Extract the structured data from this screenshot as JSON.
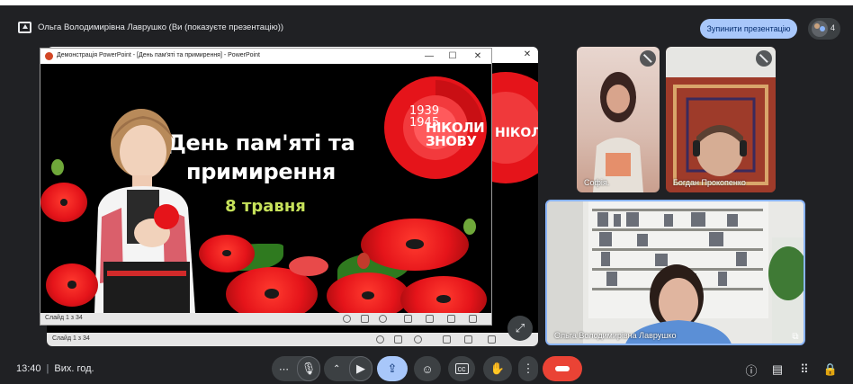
{
  "header": {
    "title": "Ольга Володимирівна Лаврушко (Ви (показуєте презентацію))",
    "stop_button": "Зупинити презентацію",
    "participants_count": "4"
  },
  "presentation": {
    "window_title": "Демонстрація PowerPoint - [День пам'яті та примирення] - PowerPoint",
    "slide_counter": "Слайд 1 з 34",
    "back_slide_counter": "Слайд 1 з 34",
    "slide": {
      "heading_line1": "День пам'яті та",
      "heading_line2": "примирення",
      "date": "8 травня",
      "emblem_years_top": "1939",
      "emblem_years_bottom": "1945",
      "emblem_line1": "НІКОЛИ",
      "emblem_line2": "ЗНОВУ"
    }
  },
  "participants": [
    {
      "name": "Софія.",
      "muted": true
    },
    {
      "name": "Богдан Прокопенко",
      "muted": true
    },
    {
      "name": "Ольга Володимирівна Лаврушко",
      "muted": false
    }
  ],
  "bottom_bar": {
    "time": "13:40",
    "meeting_label": "Вих. год."
  },
  "colors": {
    "background": "#202124",
    "accent": "#a8c7fa",
    "end_call": "#ea4335",
    "slide_date": "#c6e15a",
    "poppy_red": "#e5141a"
  },
  "icons": {
    "present": "present-screen-icon",
    "mic": "mic-icon",
    "camera": "camera-icon",
    "emoji": "emoji-icon",
    "captions": "captions-icon",
    "raise_hand": "hand-icon",
    "more": "more-vert-icon",
    "end_call": "end-call-icon",
    "info": "info-icon",
    "chat": "chat-icon",
    "activities": "apps-icon",
    "host_controls": "lock-person-icon"
  }
}
